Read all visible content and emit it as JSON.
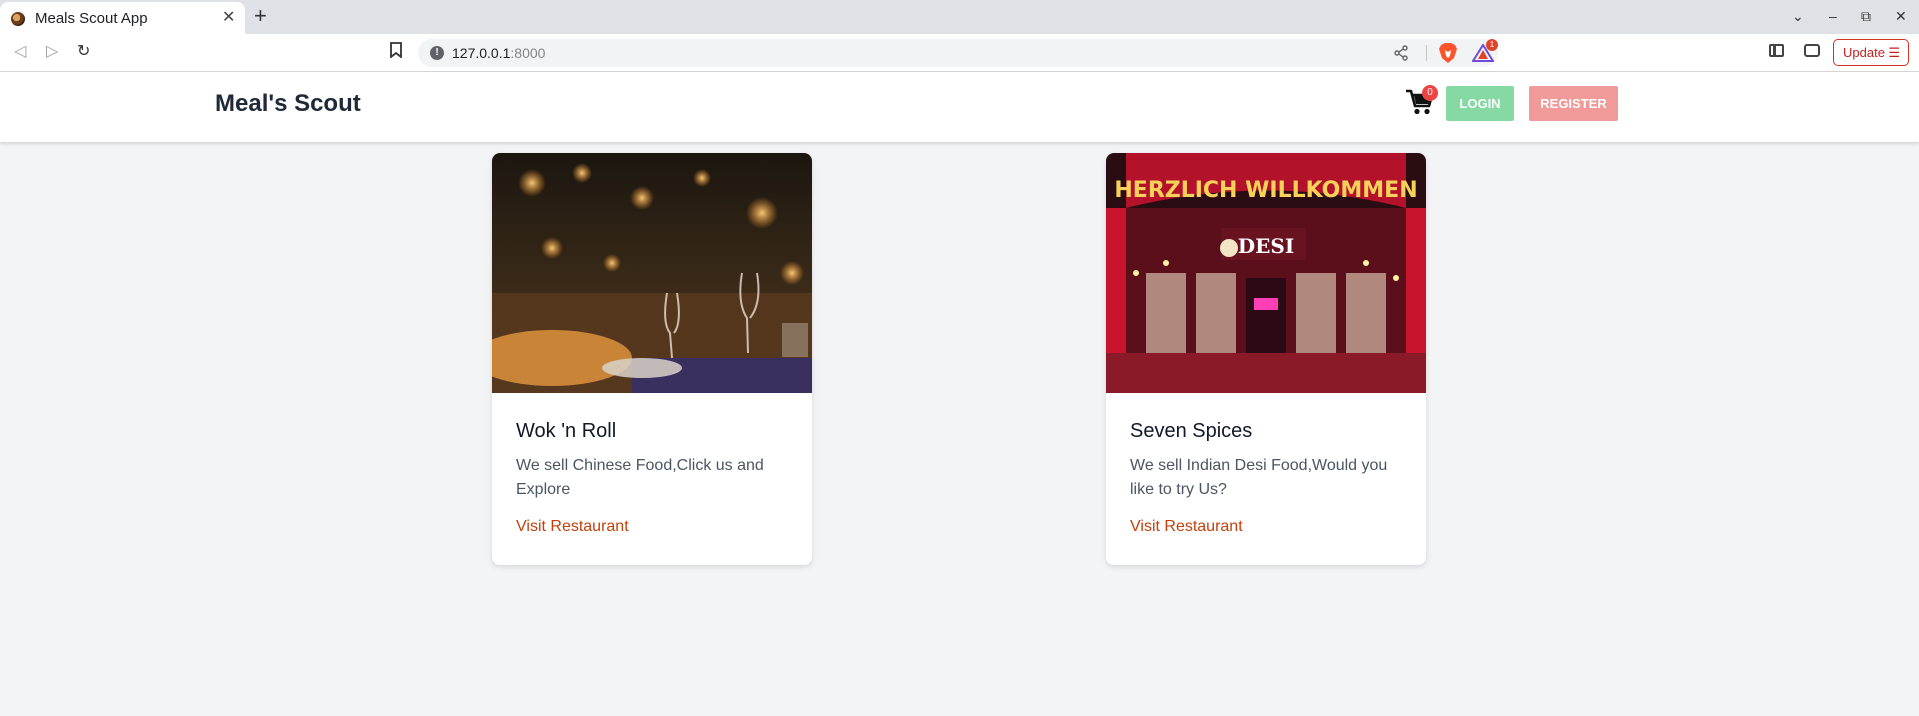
{
  "browser": {
    "tab_title": "Meals Scout App",
    "tab_close": "✕",
    "new_tab": "+",
    "url_host": "127.0.0.1",
    "url_port": ":8000",
    "rewards_count": "1",
    "update_label": "Update",
    "update_menu": "☰",
    "icons": [
      "back-icon",
      "forward-icon",
      "reload-icon",
      "bookmark-icon",
      "info-icon",
      "share-icon",
      "brave-shields-icon",
      "brave-rewards-icon",
      "sidebar-icon",
      "wallet-icon",
      "tab-list-icon",
      "minimize-icon",
      "restore-icon",
      "close-icon"
    ]
  },
  "header": {
    "brand": "Meal's Scout",
    "cart_count": "0",
    "login_label": "LOGIN",
    "register_label": "REGISTER"
  },
  "restaurants": [
    {
      "name": "Wok 'n Roll",
      "description": "We sell Chinese Food,Click us and Explore",
      "link_label": "Visit Restaurant"
    },
    {
      "name": "Seven Spices",
      "description": "We sell Indian Desi Food,Would you like to try Us?",
      "link_label": "Visit Restaurant",
      "sign_text": "HERZLICH WILLKOMMEN",
      "sign_logo": "DESI"
    }
  ],
  "colors": {
    "login_bg": "#86d9a3",
    "register_bg": "#f19a9a",
    "link": "#c2410c",
    "page_bg": "#f3f4f6"
  }
}
